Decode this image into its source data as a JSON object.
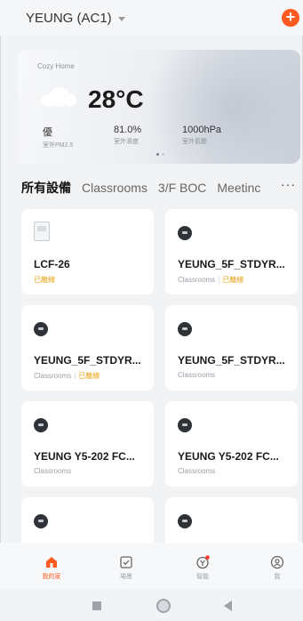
{
  "header": {
    "home_name": "YEUNG (AC1)",
    "add_label": "+"
  },
  "weather": {
    "title": "Cozy Home",
    "temperature": "28°C",
    "stats": [
      {
        "value": "優",
        "label": "室外PM2.5"
      },
      {
        "value": "81.0%",
        "label": "室外濕度"
      },
      {
        "value": "1000hPa",
        "label": "室外氣壓"
      }
    ]
  },
  "tabs": [
    "所有設備",
    "Classrooms",
    "3/F BOC",
    "Meetinc"
  ],
  "more_label": "···",
  "devices": [
    {
      "name": "LCF-26",
      "room": "",
      "status": "已離線"
    },
    {
      "name": "YEUNG_5F_STDYR...",
      "room": "Classrooms",
      "status": "已離線"
    },
    {
      "name": "YEUNG_5F_STDYR...",
      "room": "Classrooms",
      "status": "已離線"
    },
    {
      "name": "YEUNG_5F_STDYR...",
      "room": "Classrooms",
      "status": ""
    },
    {
      "name": "YEUNG Y5-202 FC...",
      "room": "Classrooms",
      "status": ""
    },
    {
      "name": "YEUNG Y5-202 FC...",
      "room": "Classrooms",
      "status": ""
    },
    {
      "name": "",
      "room": "",
      "status": ""
    },
    {
      "name": "",
      "room": "",
      "status": ""
    }
  ],
  "nav": [
    {
      "label": "我的家",
      "icon": "home-icon"
    },
    {
      "label": "場景",
      "icon": "scene-icon"
    },
    {
      "label": "智能",
      "icon": "smart-icon"
    },
    {
      "label": "我",
      "icon": "profile-icon"
    }
  ],
  "colors": {
    "accent": "#ff5a1f",
    "offline": "#e8a51b"
  }
}
